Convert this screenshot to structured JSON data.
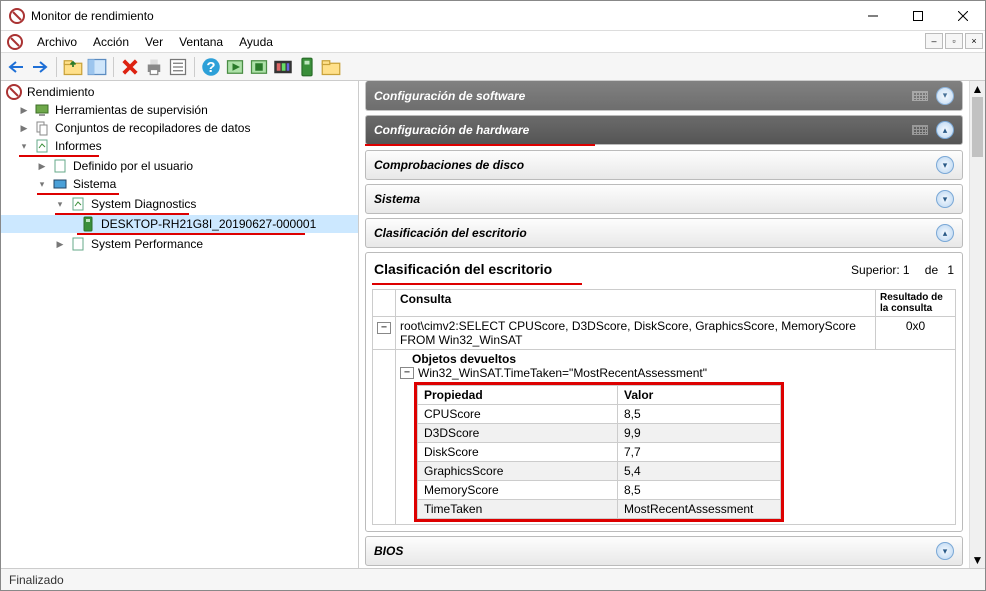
{
  "title": "Monitor de rendimiento",
  "menus": {
    "file": "Archivo",
    "action": "Acción",
    "view": "Ver",
    "window": "Ventana",
    "help": "Ayuda"
  },
  "tree": {
    "root": "Rendimiento",
    "monitoring": "Herramientas de supervisión",
    "collectors": "Conjuntos de recopiladores de datos",
    "reports": "Informes",
    "userdefined": "Definido por el usuario",
    "system": "Sistema",
    "diagnostics": "System Diagnostics",
    "report_item": "DESKTOP-RH21G8I_20190627-000001",
    "performance": "System Performance"
  },
  "bars": {
    "sw_config": "Configuración de software",
    "hw_config": "Configuración de hardware",
    "disk_checks": "Comprobaciones de disco",
    "system": "Sistema",
    "desk_class": "Clasificación del escritorio",
    "bios": "BIOS"
  },
  "section": {
    "title": "Clasificación del escritorio",
    "pager_label": "Superior:",
    "pager_cur": "1",
    "pager_of": "de",
    "pager_total": "1",
    "th_query": "Consulta",
    "th_result": "Resultado de la consulta",
    "query": "root\\cimv2:SELECT CPUScore, D3DScore, DiskScore, GraphicsScore, MemoryScore FROM Win32_WinSAT",
    "result": "0x0",
    "returned_objects": "Objetos devueltos",
    "where": "Win32_WinSAT.TimeTaken=\"MostRecentAssessment\"",
    "th_prop": "Propiedad",
    "th_val": "Valor",
    "rows": [
      {
        "p": "CPUScore",
        "v": "8,5"
      },
      {
        "p": "D3DScore",
        "v": "9,9"
      },
      {
        "p": "DiskScore",
        "v": "7,7"
      },
      {
        "p": "GraphicsScore",
        "v": "5,4"
      },
      {
        "p": "MemoryScore",
        "v": "8,5"
      },
      {
        "p": "TimeTaken",
        "v": "MostRecentAssessment"
      }
    ]
  },
  "status": "Finalizado"
}
